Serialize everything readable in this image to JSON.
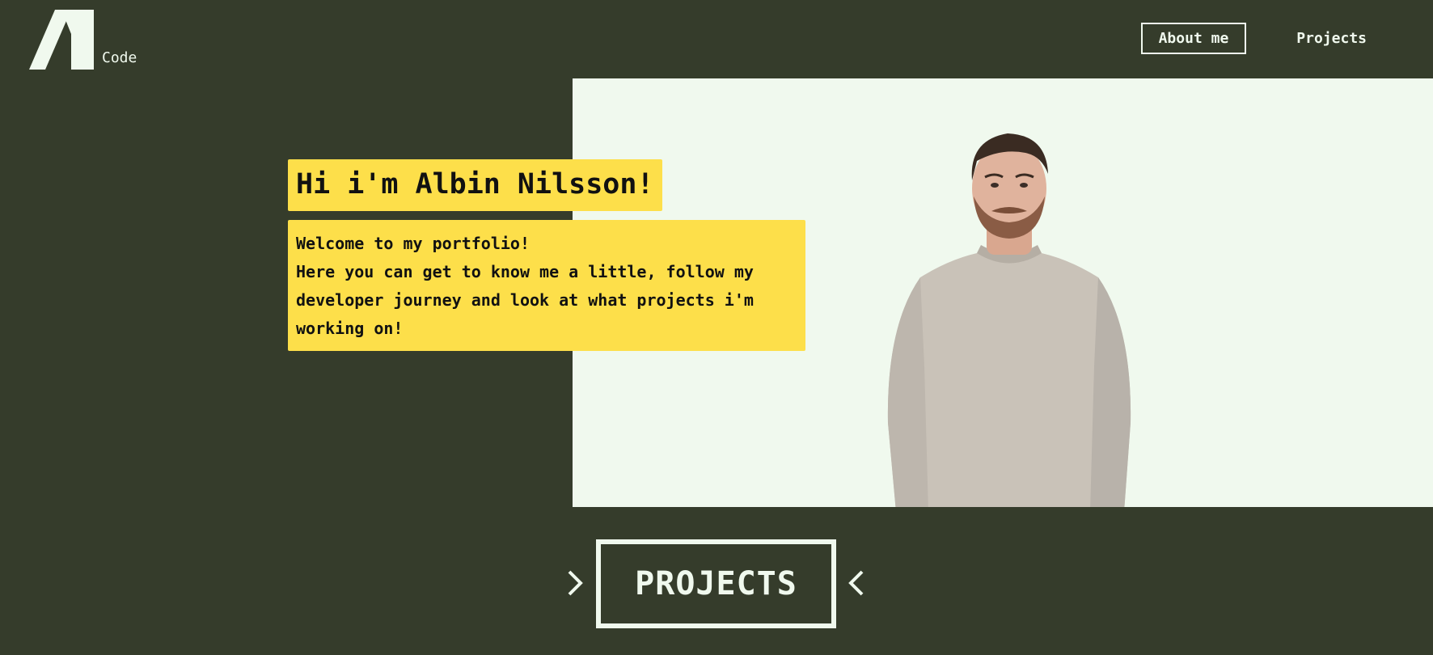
{
  "header": {
    "logo_icon": "an-logo-icon",
    "logo_text": "Code",
    "nav": [
      {
        "label": "About me",
        "active": true
      },
      {
        "label": "Projects",
        "active": false
      }
    ]
  },
  "hero": {
    "headline": "Hi i'm Albin Nilsson!",
    "intro_lines": [
      "Welcome to my portfolio!",
      "Here you can get to know me a little, follow my developer journey and look at what projects i'm working on!"
    ],
    "photo_icon": "portrait-photo"
  },
  "projects": {
    "label": "PROJECTS",
    "left_icon": "chevron-right-icon",
    "right_icon": "chevron-left-icon"
  },
  "colors": {
    "background": "#353c2b",
    "accent_yellow": "#fddf4a",
    "light": "#f0f9ee"
  }
}
